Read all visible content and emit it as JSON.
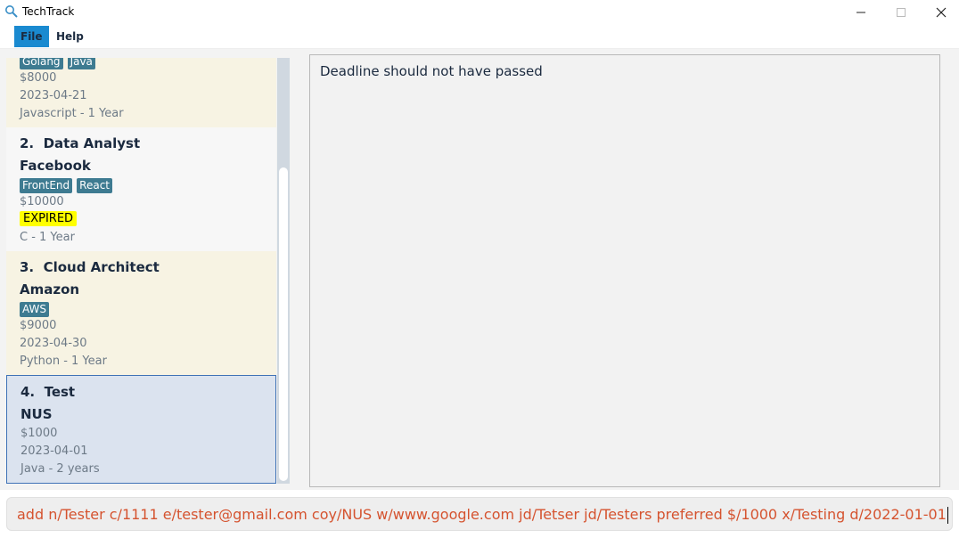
{
  "window": {
    "title": "TechTrack",
    "icon": "magnifier-icon",
    "controls": {
      "minimize": "—",
      "maximize": "☐",
      "close": "✕"
    }
  },
  "menu": {
    "file": "File",
    "help": "Help"
  },
  "jobs": [
    {
      "tags": [
        "Golang",
        "Java"
      ],
      "salary": "$8000",
      "deadline": "2023-04-21",
      "experience": "Javascript - 1 Year"
    },
    {
      "index": "2.",
      "role": "Data Analyst",
      "company": "Facebook",
      "tags": [
        "FrontEnd",
        "React"
      ],
      "salary": "$10000",
      "status": "EXPIRED",
      "experience": "C - 1 Year"
    },
    {
      "index": "3.",
      "role": "Cloud Architect",
      "company": "Amazon",
      "tags": [
        "AWS"
      ],
      "salary": "$9000",
      "deadline": "2023-04-30",
      "experience": "Python - 1 Year"
    },
    {
      "index": "4.",
      "role": "Test",
      "company": "NUS",
      "salary": "$1000",
      "deadline": "2023-04-01",
      "experience": "Java - 2 years"
    }
  ],
  "result": {
    "message": "Deadline should not have passed"
  },
  "command": {
    "value": "add n/Tester c/1111 e/tester@gmail.com coy/NUS w/www.google.com jd/Tetser jd/Testers preferred $/1000 x/Testing d/2022-01-01"
  },
  "colors": {
    "accent": "#1a8ad0",
    "tag": "#3e7b91",
    "expired": "#ffff00",
    "command_error": "#d5532f",
    "selected_border": "#3f72b6"
  }
}
